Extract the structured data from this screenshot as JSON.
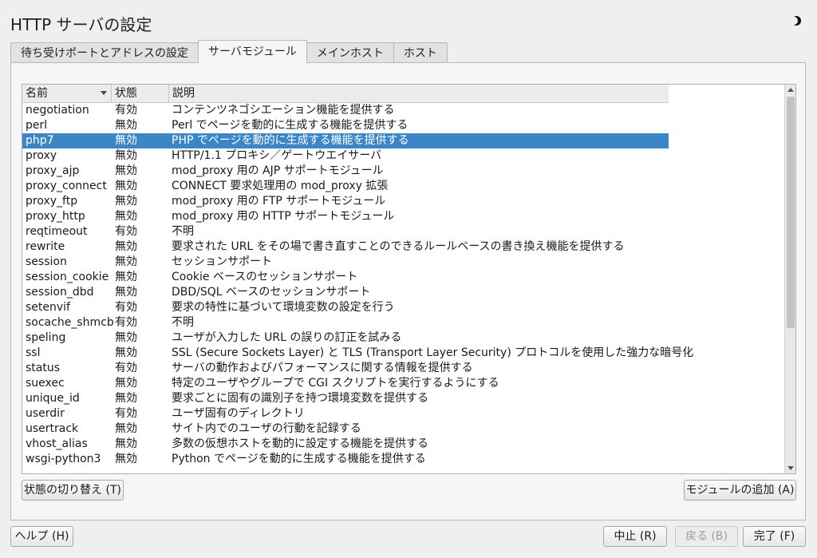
{
  "window": {
    "title": "HTTP サーバの設定"
  },
  "tabs": [
    {
      "label": "待ち受けポートとアドレスの設定"
    },
    {
      "label": "サーバモジュール"
    },
    {
      "label": "メインホスト"
    },
    {
      "label": "ホスト"
    }
  ],
  "table": {
    "columns": [
      "名前",
      "状態",
      "説明"
    ],
    "selected_row": 2,
    "rows": [
      {
        "name": "negotiation",
        "state": "有効",
        "desc": "コンテンツネゴシエーション機能を提供する"
      },
      {
        "name": "perl",
        "state": "無効",
        "desc": "Perl でページを動的に生成する機能を提供する"
      },
      {
        "name": "php7",
        "state": "無効",
        "desc": "PHP でページを動的に生成する機能を提供する"
      },
      {
        "name": "proxy",
        "state": "無効",
        "desc": "HTTP/1.1 プロキシ／ゲートウエイサーバ"
      },
      {
        "name": "proxy_ajp",
        "state": "無効",
        "desc": "mod_proxy 用の AJP サポートモジュール"
      },
      {
        "name": "proxy_connect",
        "state": "無効",
        "desc": "CONNECT 要求処理用の mod_proxy 拡張"
      },
      {
        "name": "proxy_ftp",
        "state": "無効",
        "desc": "mod_proxy 用の FTP サポートモジュール"
      },
      {
        "name": "proxy_http",
        "state": "無効",
        "desc": "mod_proxy 用の HTTP サポートモジュール"
      },
      {
        "name": "reqtimeout",
        "state": "有効",
        "desc": "不明"
      },
      {
        "name": "rewrite",
        "state": "無効",
        "desc": "要求された URL をその場で書き直すことのできるルールベースの書き換え機能を提供する"
      },
      {
        "name": "session",
        "state": "無効",
        "desc": "セッションサポート"
      },
      {
        "name": "session_cookie",
        "state": "無効",
        "desc": "Cookie ベースのセッションサポート"
      },
      {
        "name": "session_dbd",
        "state": "無効",
        "desc": "DBD/SQL ベースのセッションサポート"
      },
      {
        "name": "setenvif",
        "state": "有効",
        "desc": "要求の特性に基づいて環境変数の設定を行う"
      },
      {
        "name": "socache_shmcb",
        "state": "有効",
        "desc": "不明"
      },
      {
        "name": "speling",
        "state": "無効",
        "desc": "ユーザが入力した URL の誤りの訂正を試みる"
      },
      {
        "name": "ssl",
        "state": "無効",
        "desc": "SSL (Secure Sockets Layer) と TLS (Transport Layer Security) プロトコルを使用した強力な暗号化"
      },
      {
        "name": "status",
        "state": "有効",
        "desc": "サーバの動作およびパフォーマンスに関する情報を提供する"
      },
      {
        "name": "suexec",
        "state": "無効",
        "desc": "特定のユーザやグループで CGI スクリプトを実行するようにする"
      },
      {
        "name": "unique_id",
        "state": "無効",
        "desc": "要求ごとに固有の識別子を持つ環境変数を提供する"
      },
      {
        "name": "userdir",
        "state": "有効",
        "desc": "ユーザ固有のディレクトリ"
      },
      {
        "name": "usertrack",
        "state": "無効",
        "desc": "サイト内でのユーザの行動を記録する"
      },
      {
        "name": "vhost_alias",
        "state": "無効",
        "desc": "多数の仮想ホストを動的に設定する機能を提供する"
      },
      {
        "name": "wsgi-python3",
        "state": "無効",
        "desc": "Python でページを動的に生成する機能を提供する"
      }
    ]
  },
  "buttons": {
    "toggle_state": "状態の切り替え (T)",
    "add_module": "モジュールの追加 (A)",
    "help": "ヘルプ (H)",
    "abort": "中止 (R)",
    "back": "戻る (B)",
    "finish": "完了 (F)"
  },
  "icons": {
    "theme": "moon-icon",
    "sort": "sort-desc-icon"
  }
}
